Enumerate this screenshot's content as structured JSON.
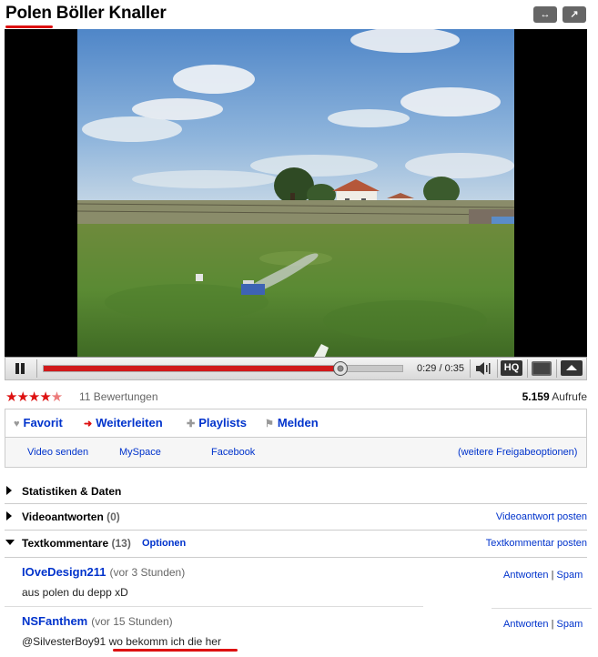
{
  "video": {
    "title": "Polen Böller Knaller",
    "progress_fraction": 0.828,
    "time_display": "0:29 / 0:35",
    "hq_label": "HQ"
  },
  "rating": {
    "stars": 4.5,
    "count_label": "11 Bewertungen",
    "views_number": "5.159",
    "views_label": "Aufrufe"
  },
  "actions": {
    "tabs": [
      "Favorit",
      "Weiterleiten",
      "Playlists",
      "Melden"
    ],
    "share_links": [
      "Video senden",
      "MySpace",
      "Facebook",
      "(weitere Freigabeoptionen)"
    ]
  },
  "sections": {
    "stats": {
      "title": "Statistiken & Daten"
    },
    "video_responses": {
      "title": "Videoantworten",
      "count": "(0)",
      "link": "Videoantwort posten"
    },
    "text_comments": {
      "title": "Textkommentare",
      "count": "(13)",
      "options": "Optionen",
      "link": "Textkommentar posten"
    }
  },
  "comments": [
    {
      "author": "IOveDesign211",
      "time": "(vor 3 Stunden)",
      "text": "aus polen du depp xD",
      "reply": "Antworten",
      "spam": "Spam"
    },
    {
      "author": "NSFanthem",
      "time": "(vor 15 Stunden)",
      "text_prefix": "@SilvesterBoy91 ",
      "text_highlight": "wo bekomm ich die her",
      "reply": "Antworten",
      "spam": "Spam"
    }
  ],
  "colors": {
    "accent": "#d11111",
    "link": "#0033cc"
  },
  "icons": {
    "resize": "resize-icon",
    "popout": "popout-icon",
    "volume": "volume-icon"
  }
}
